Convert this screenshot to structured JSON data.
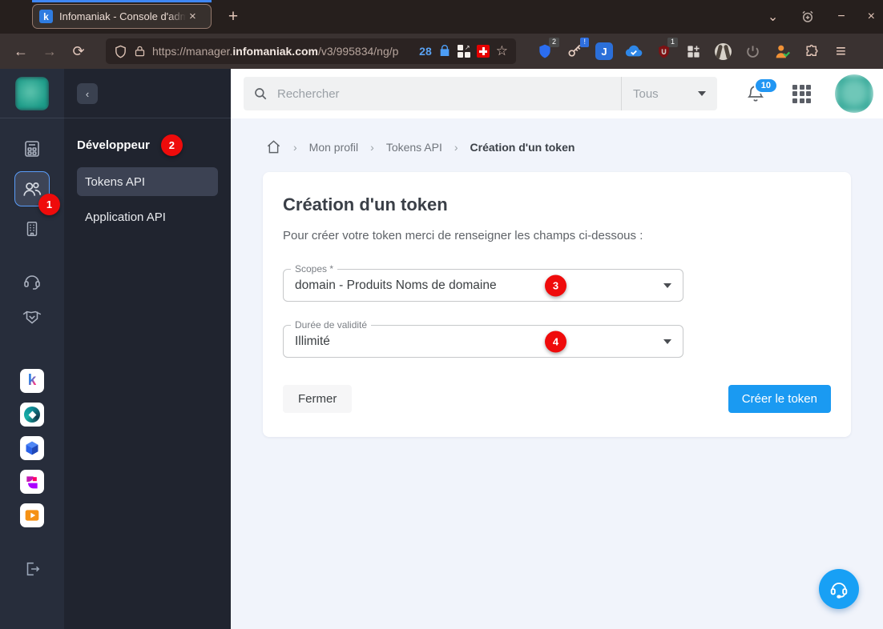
{
  "browser": {
    "tab_title": "Infomaniak - Console d'adm",
    "favicon_letter": "k",
    "url": {
      "scheme_host": "https://manager.",
      "domain": "infomaniak.com",
      "path": "/v3/995834/ng/p"
    },
    "url_item_count": "28",
    "extension_badges": {
      "shield": "2",
      "key": "!",
      "ublock": "1"
    },
    "ext_j_letter": "J"
  },
  "icons": {
    "back": "←",
    "forward": "→",
    "reload": "⟳",
    "new_tab": "+",
    "tab_close": "×",
    "tab_list_chevron": "⌄",
    "minimize": "−",
    "window_close": "×",
    "menu": "≡",
    "star": "☆",
    "container_arrow": "↗",
    "collapse": "‹",
    "crumb_sep": "›"
  },
  "header": {
    "search_placeholder": "Rechercher",
    "filter_label": "Tous",
    "notification_count": "10"
  },
  "breadcrumb": {
    "items": [
      "Mon profil",
      "Tokens API",
      "Création d'un token"
    ]
  },
  "panel": {
    "heading": "Développeur",
    "items": [
      {
        "label": "Tokens API"
      },
      {
        "label": "Application API"
      }
    ]
  },
  "card": {
    "title": "Création d'un token",
    "subtitle": "Pour créer votre token merci de renseigner les champs ci-dessous :",
    "fields": [
      {
        "label": "Scopes *",
        "value": "domain - Produits Noms de domaine"
      },
      {
        "label": "Durée de validité",
        "value": "Illimité"
      }
    ],
    "close_label": "Fermer",
    "submit_label": "Créer le token"
  },
  "annotations": {
    "steps": [
      "1",
      "2",
      "3",
      "4"
    ]
  },
  "colors": {
    "accent_blue": "#1a9af2",
    "badge_red": "#ef0b0b",
    "rail_bg": "#272d3b",
    "panel_bg": "#20242f",
    "content_bg": "#f1f4fb",
    "tab_accent": "#3f87f5",
    "avatar_teal": "#2ba393",
    "swiss_flag_red": "#e60000"
  }
}
